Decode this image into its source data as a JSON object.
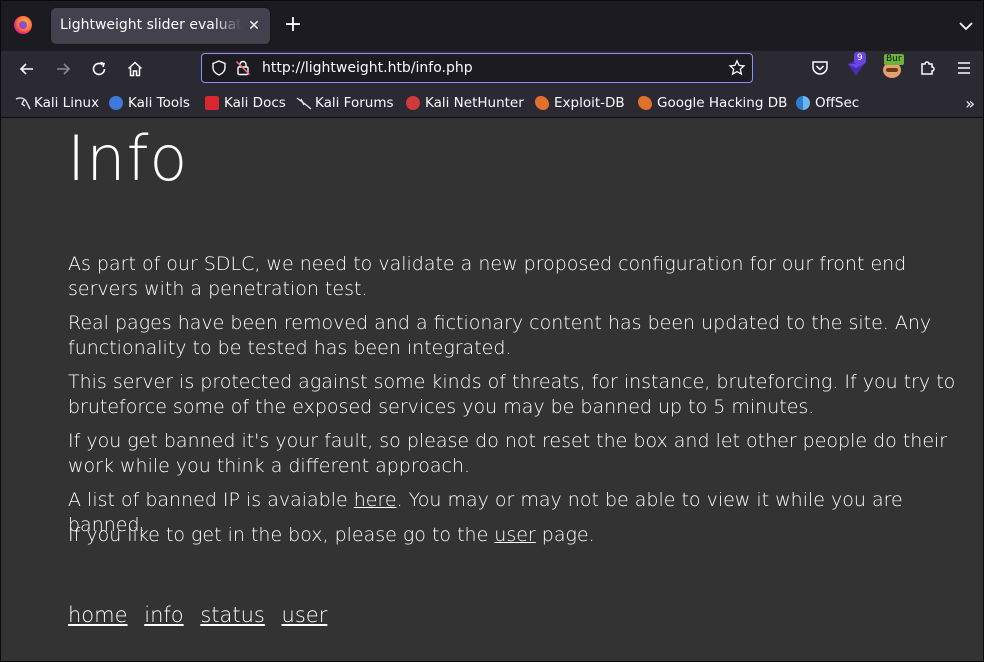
{
  "tab": {
    "title": "Lightweight slider evaluation",
    "close": "✕"
  },
  "urlbar": {
    "url": "http://lightweight.htb/info.php"
  },
  "extensions": {
    "ublock_badge": "9",
    "burp_badge": "Bur"
  },
  "bookmarks": [
    {
      "label": "Kali Linux",
      "icon": "kali-dragon-icon"
    },
    {
      "label": "Kali Tools",
      "icon": "kali-tools-icon"
    },
    {
      "label": "Kali Docs",
      "icon": "kali-docs-icon"
    },
    {
      "label": "Kali Forums",
      "icon": "kali-forums-icon"
    },
    {
      "label": "Kali NetHunter",
      "icon": "nethunter-icon"
    },
    {
      "label": "Exploit-DB",
      "icon": "exploit-db-icon"
    },
    {
      "label": "Google Hacking DB",
      "icon": "ghdb-icon"
    },
    {
      "label": "OffSec",
      "icon": "offsec-icon"
    }
  ],
  "page": {
    "title": "Info",
    "p1": "As part of our SDLC, we need to validate a new proposed configuration for our front end servers with a penetration test.",
    "p2": "Real pages have been removed and a fictionary content has been updated to the site. Any functionality to be tested has been integrated.",
    "p3": "This server is protected against some kinds of threats, for instance, bruteforcing. If you try to bruteforce some of the exposed services you may be banned up to 5 minutes.",
    "p4": "If you get banned it's your fault, so please do not reset the box and let other people do their work while you think a different approach.",
    "p5_before": "A list of banned IP is avaiable ",
    "p5_link": "here",
    "p5_after": ". You may or may not be able to view it while you are banned.",
    "p6_before": "If you like to get in the box, please go to the ",
    "p6_link": "user",
    "p6_after": " page.",
    "footer_links": [
      "home",
      "info",
      "status",
      "user"
    ]
  },
  "colors": {
    "content_bg": "#333333",
    "chrome_bg": "#2b2a33",
    "accent": "#8f8ff8"
  }
}
